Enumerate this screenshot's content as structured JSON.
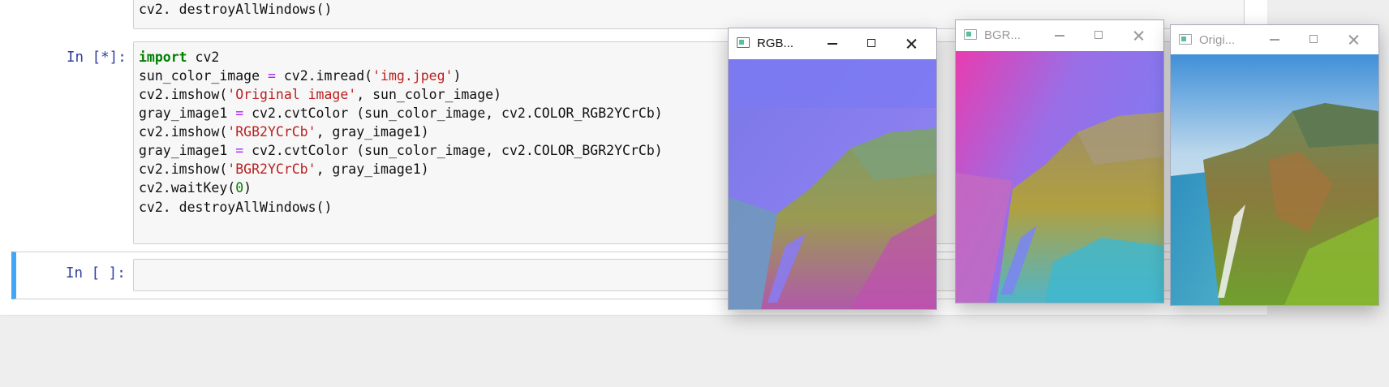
{
  "notebook": {
    "prev_cell": {
      "last_line": "cv2. destroyAllWindows()"
    },
    "running_cell": {
      "prompt": "In [*]:",
      "code": {
        "l1_kw": "import",
        "l1_rest": " cv2",
        "l2_a": "sun_color_image ",
        "l2_op": "=",
        "l2_b": " cv2.imread(",
        "l2_str": "'img.jpeg'",
        "l2_c": ")",
        "l3_a": "cv2.imshow(",
        "l3_str": "'Original image'",
        "l3_b": ", sun_color_image)",
        "l4_a": "gray_image1 ",
        "l4_op": "=",
        "l4_b": " cv2.cvtColor (sun_color_image, cv2.COLOR_RGB2YCrCb)",
        "l5_a": "cv2.imshow(",
        "l5_str": "'RGB2YCrCb'",
        "l5_b": ", gray_image1)",
        "l6_a": "gray_image1 ",
        "l6_op": "=",
        "l6_b": " cv2.cvtColor (sun_color_image, cv2.COLOR_BGR2YCrCb)",
        "l7_a": "cv2.imshow(",
        "l7_str": "'BGR2YCrCb'",
        "l7_b": ", gray_image1)",
        "l8_a": "cv2.waitKey(",
        "l8_num": "0",
        "l8_b": ")",
        "l9": "cv2. destroyAllWindows()"
      }
    },
    "empty_cell": {
      "prompt": "In [ ]:",
      "value": ""
    }
  },
  "windows": [
    {
      "title": "RGB...",
      "active": true,
      "image": "RGB2YCrCb-converted coastline"
    },
    {
      "title": "BGR...",
      "active": false,
      "image": "BGR2YCrCb-converted coastline"
    },
    {
      "title": "Origi...",
      "active": false,
      "image": "original coastline photo"
    }
  ],
  "colors": {
    "prompt": "#303f9f",
    "keyword": "#008000",
    "string": "#ba2121",
    "operator": "#aa22ff",
    "selected_cell_bar": "#42a5f5"
  }
}
